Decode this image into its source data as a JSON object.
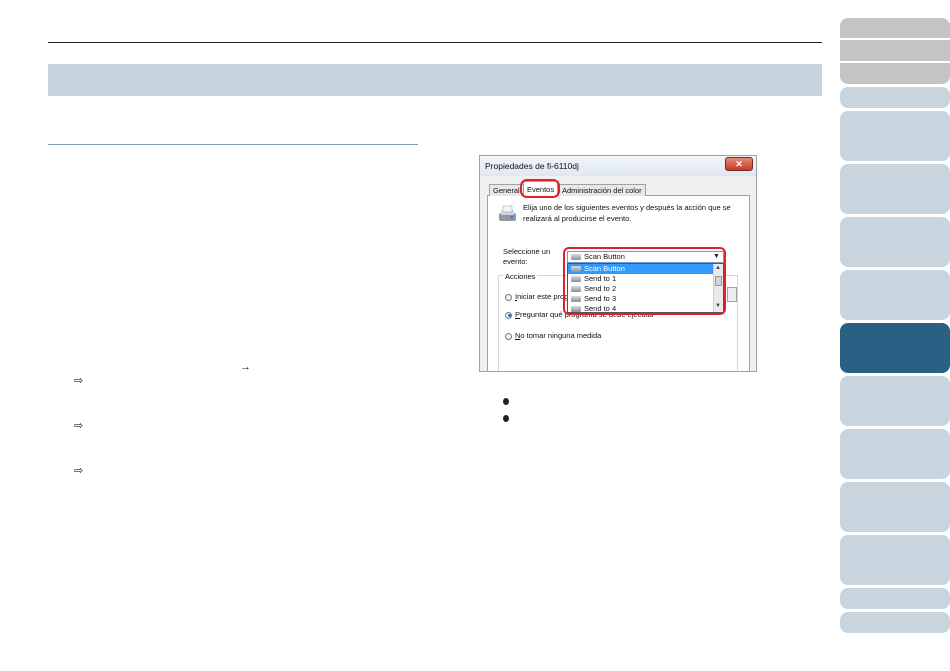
{
  "dialog": {
    "title": "Propiedades de fi-6110dj",
    "close_glyph": "✕",
    "tabs": [
      {
        "label": "General"
      },
      {
        "label": "Eventos"
      },
      {
        "label": "Administración del color"
      }
    ],
    "description": "Elija uno de los siguientes eventos y después la acción que se realizará al producirse el evento.",
    "select_label": "Seleccione un evento:",
    "selected_event": "Scan Button",
    "events": [
      "Scan Button",
      "Send to 1",
      "Send to 2",
      "Send to 3",
      "Send to 4"
    ],
    "actions_group_label": "Acciones",
    "actions": [
      {
        "accesskey": "I",
        "rest": "niciar este prog",
        "checked": false
      },
      {
        "accesskey": "P",
        "rest": "reguntar qué programa se debe ejecutar",
        "checked": true
      },
      {
        "accesskey": "N",
        "rest": "o tomar ninguna medida",
        "checked": false
      }
    ]
  },
  "markers": {
    "arrow_right": "→",
    "hollow_arrow": "⇨"
  },
  "colors": {
    "highlight": "#e0202c",
    "active_tab": "#2a6084",
    "title_band": "#c6d4dd",
    "selection": "#3399ff"
  },
  "icons": [
    "scanner-icon",
    "close-icon",
    "chevron-down-icon"
  ]
}
